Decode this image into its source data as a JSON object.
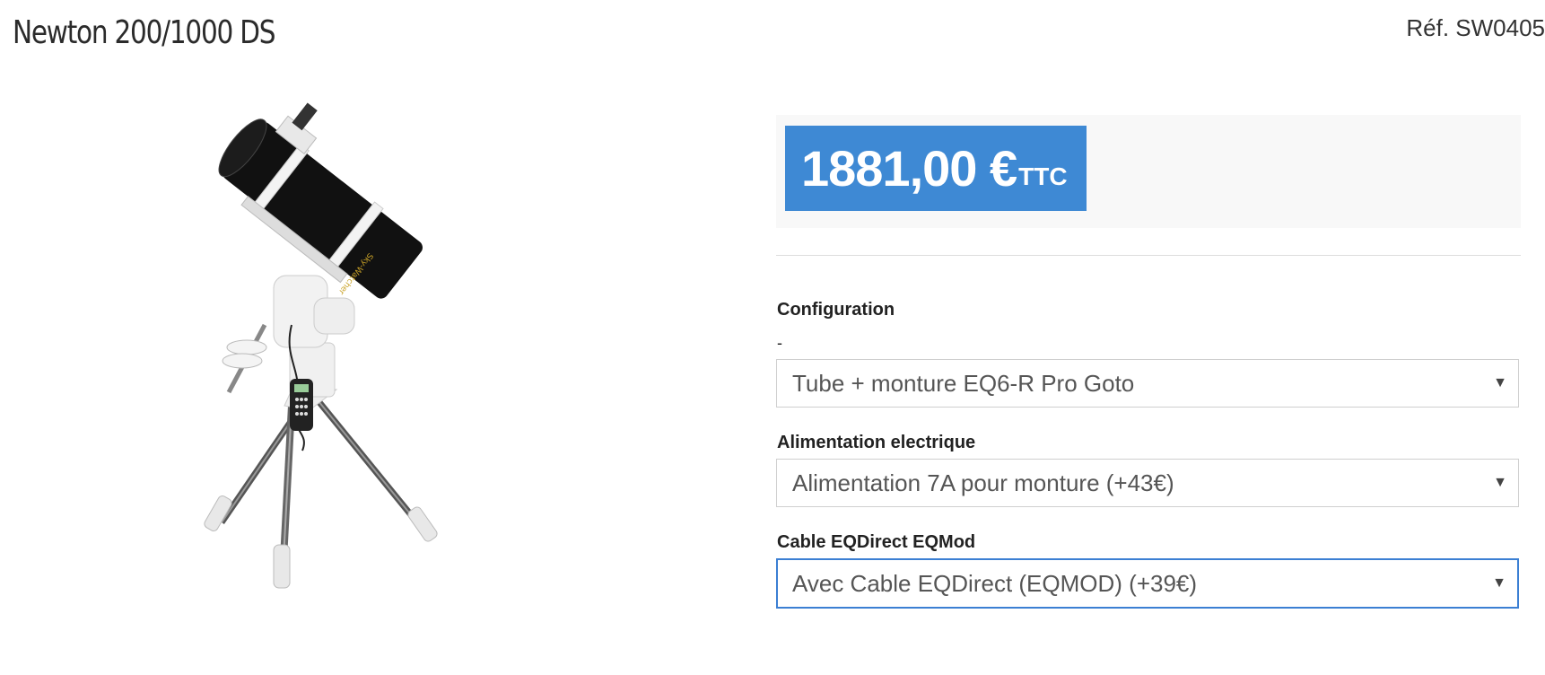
{
  "product": {
    "title": "Newton 200/1000 DS",
    "reference": "Réf. SW0405"
  },
  "price": {
    "amount": "1881,00 €",
    "tax_label": "TTC",
    "color": "#3e89d4"
  },
  "options": [
    {
      "label": "Configuration",
      "note": "-",
      "selected": "Tube + monture EQ6-R Pro Goto"
    },
    {
      "label": "Alimentation electrique",
      "selected": "Alimentation 7A pour monture (+43€)"
    },
    {
      "label": "Cable EQDirect EQMod",
      "selected": "Avec Cable EQDirect (EQMOD) (+39€)"
    }
  ],
  "icons": {
    "dropdown": "chevron-down-icon"
  }
}
